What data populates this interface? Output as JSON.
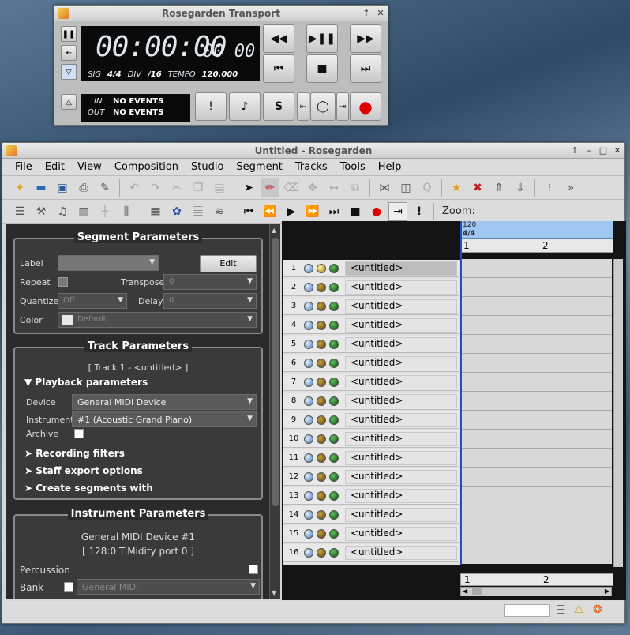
{
  "transport": {
    "title": "Rosegarden Transport",
    "time_main": "00:00:00",
    "time_sub": "00 00",
    "sig_label": "SIG",
    "sig": "4/4",
    "div_label": "DIV",
    "div": "/16",
    "tempo_label": "TEMPO",
    "tempo": "120.000",
    "in_label": "IN",
    "in_value": "NO EVENTS",
    "out_label": "OUT",
    "out_value": "NO EVENTS",
    "solo_label": "S"
  },
  "main": {
    "title": "Untitled - Rosegarden",
    "menu": [
      "File",
      "Edit",
      "View",
      "Composition",
      "Studio",
      "Segment",
      "Tracks",
      "Tools",
      "Help"
    ],
    "zoom_label": "Zoom:"
  },
  "segment_params": {
    "title": "Segment Parameters",
    "label_label": "Label",
    "edit_button": "Edit",
    "repeat_label": "Repeat",
    "transpose_label": "Transpose",
    "transpose_value": "0",
    "quantize_label": "Quantize",
    "quantize_value": "Off",
    "delay_label": "Delay",
    "delay_value": "0",
    "color_label": "Color",
    "color_value": "Default"
  },
  "track_params": {
    "title": "Track Parameters",
    "track_caption": "[ Track 1 - <untitled> ]",
    "playback": "Playback parameters",
    "device_label": "Device",
    "device_value": "General MIDI Device",
    "instrument_label": "Instrument",
    "instrument_value": "#1 (Acoustic Grand Piano)",
    "archive_label": "Archive",
    "recording": "Recording filters",
    "staff": "Staff export options",
    "create": "Create segments with"
  },
  "instrument_params": {
    "title": "Instrument Parameters",
    "device_line": "General MIDI Device  #1",
    "port_line": "[ 128:0 TiMidity port 0 ]",
    "percussion_label": "Percussion",
    "bank_label": "Bank",
    "bank_value": "General MIDI"
  },
  "tracks": [
    {
      "n": "1",
      "name": "<untitled>"
    },
    {
      "n": "2",
      "name": "<untitled>"
    },
    {
      "n": "3",
      "name": "<untitled>"
    },
    {
      "n": "4",
      "name": "<untitled>"
    },
    {
      "n": "5",
      "name": "<untitled>"
    },
    {
      "n": "6",
      "name": "<untitled>"
    },
    {
      "n": "7",
      "name": "<untitled>"
    },
    {
      "n": "8",
      "name": "<untitled>"
    },
    {
      "n": "9",
      "name": "<untitled>"
    },
    {
      "n": "10",
      "name": "<untitled>"
    },
    {
      "n": "11",
      "name": "<untitled>"
    },
    {
      "n": "12",
      "name": "<untitled>"
    },
    {
      "n": "13",
      "name": "<untitled>"
    },
    {
      "n": "14",
      "name": "<untitled>"
    },
    {
      "n": "15",
      "name": "<untitled>"
    },
    {
      "n": "16",
      "name": "<untitled>"
    }
  ],
  "ruler": {
    "tempo": "120",
    "sig": "4/4",
    "bar1": "1",
    "bar2": "2"
  }
}
